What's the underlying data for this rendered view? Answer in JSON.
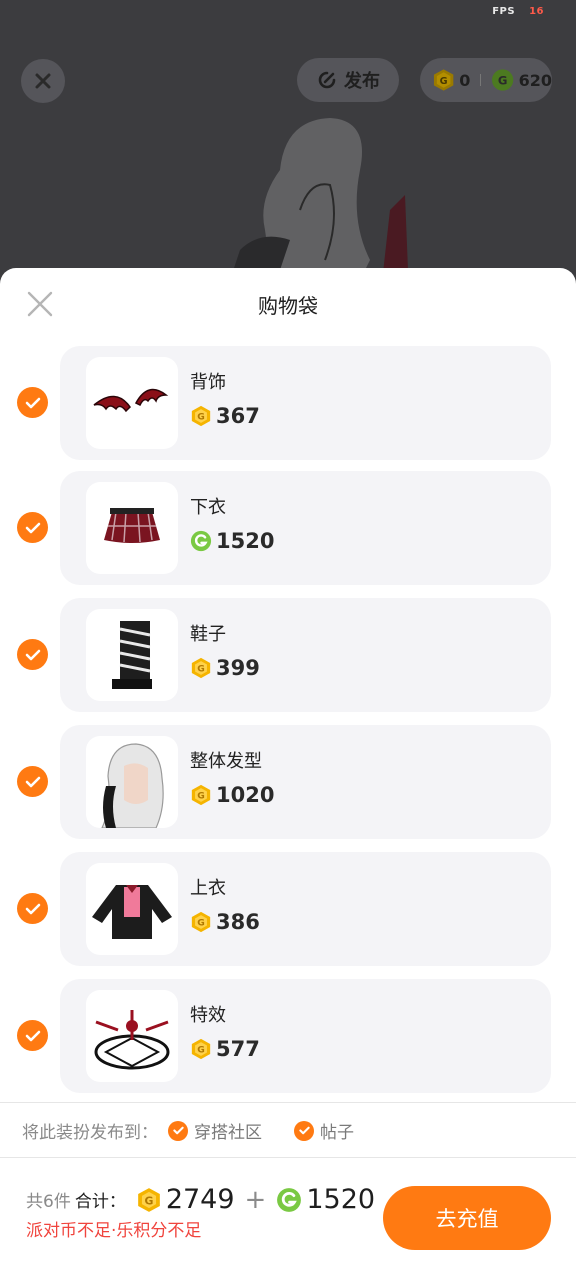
{
  "status": {
    "fps_label": "FPS",
    "fps_value": "16"
  },
  "topbar": {
    "publish_label": "发布",
    "party_coins": "0",
    "joy_points": "620"
  },
  "sheet": {
    "title": "购物袋",
    "items": [
      {
        "name": "背饰",
        "currency": "party-coin",
        "price": "367",
        "checked": true
      },
      {
        "name": "下衣",
        "currency": "joy-point",
        "price": "1520",
        "checked": true
      },
      {
        "name": "鞋子",
        "currency": "party-coin",
        "price": "399",
        "checked": true
      },
      {
        "name": "整体发型",
        "currency": "party-coin",
        "price": "1020",
        "checked": true
      },
      {
        "name": "上衣",
        "currency": "party-coin",
        "price": "386",
        "checked": true
      },
      {
        "name": "特效",
        "currency": "party-coin",
        "price": "577",
        "checked": true
      }
    ],
    "publish_to": {
      "label": "将此装扮发布到：",
      "options": [
        {
          "label": "穿搭社区",
          "checked": true
        },
        {
          "label": "帖子",
          "checked": true
        }
      ]
    },
    "footer": {
      "count_text": "共6件",
      "total_label": "合计：",
      "party_coin_total": "2749",
      "joy_point_total": "1520",
      "warning": "派对币不足·乐积分不足",
      "recharge_label": "去充值"
    }
  },
  "colors": {
    "accent": "#ff7a12",
    "warning": "#f0443d",
    "coin_gold": "#f5b400",
    "coin_green": "#7ac943"
  }
}
